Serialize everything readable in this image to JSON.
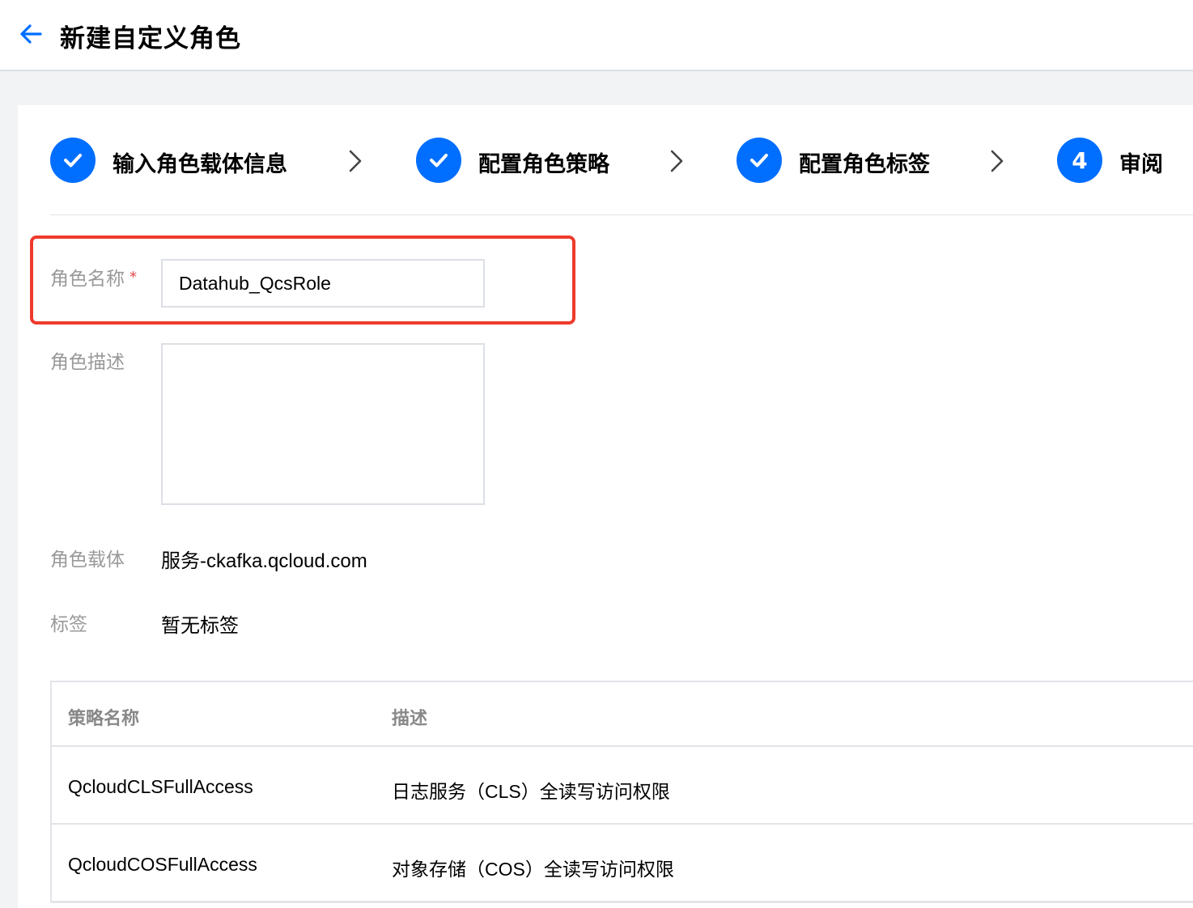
{
  "header": {
    "title": "新建自定义角色",
    "back_icon": "arrow-left-icon",
    "accent_color": "#006eff"
  },
  "steps": [
    {
      "label": "输入角色载体信息",
      "status": "done",
      "indicator": "✓"
    },
    {
      "label": "配置角色策略",
      "status": "done",
      "indicator": "✓"
    },
    {
      "label": "配置角色标签",
      "status": "done",
      "indicator": "✓"
    },
    {
      "label": "审阅",
      "status": "current",
      "indicator": "4"
    }
  ],
  "form": {
    "role_name_label": "角色名称",
    "role_name_required": "*",
    "role_name_value": "Datahub_QcsRole",
    "role_desc_label": "角色描述",
    "role_desc_value": "",
    "role_carrier_label": "角色载体",
    "role_carrier_value": "服务-ckafka.qcloud.com",
    "tags_label": "标签",
    "tags_value": "暂无标签"
  },
  "policy_table": {
    "columns": [
      "策略名称",
      "描述"
    ],
    "rows": [
      {
        "name": "QcloudCLSFullAccess",
        "description": "日志服务（CLS）全读写访问权限"
      },
      {
        "name": "QcloudCOSFullAccess",
        "description": "对象存储（COS）全读写访问权限"
      }
    ]
  },
  "highlight_color": "#ee3b2d"
}
